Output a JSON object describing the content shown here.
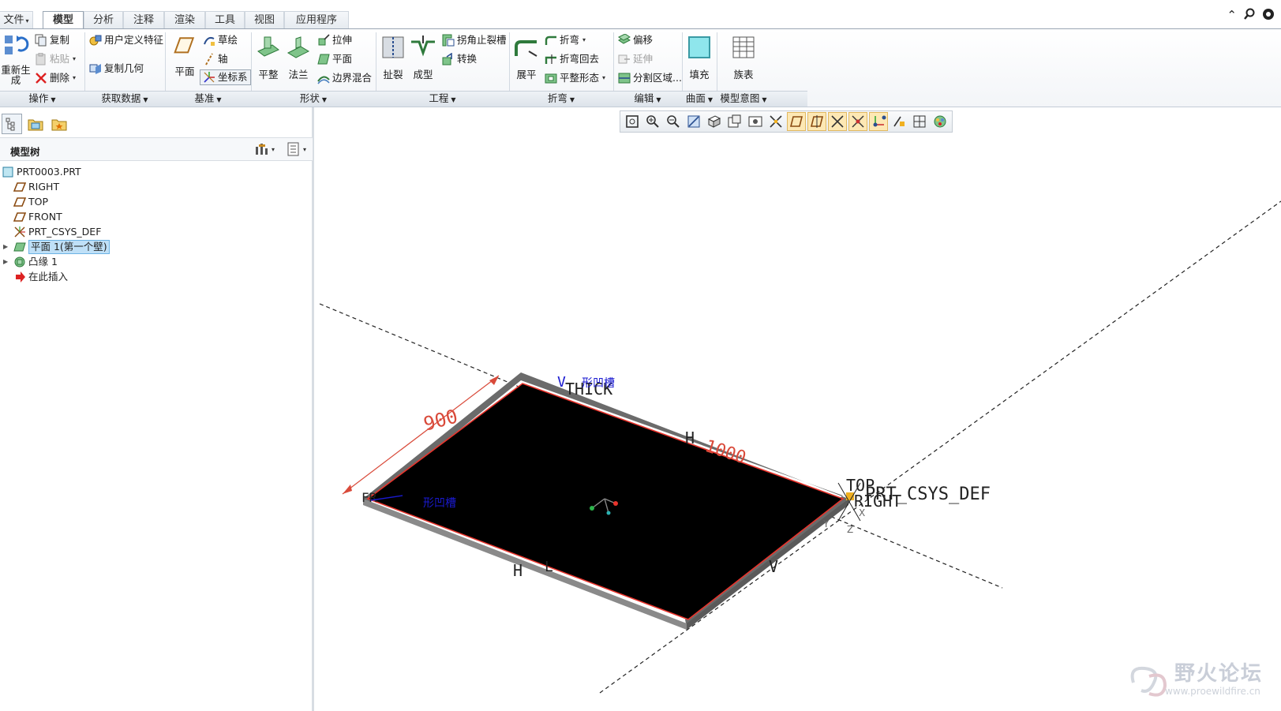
{
  "tabs": [
    {
      "label": "文件",
      "active": false,
      "has_dropdown": true
    },
    {
      "label": "模型",
      "active": true
    },
    {
      "label": "分析",
      "active": false
    },
    {
      "label": "注释",
      "active": false
    },
    {
      "label": "渲染",
      "active": false
    },
    {
      "label": "工具",
      "active": false
    },
    {
      "label": "视图",
      "active": false
    },
    {
      "label": "应用程序",
      "active": false
    }
  ],
  "ribbon": {
    "operations": {
      "regenerate": "重新生成",
      "copy": "复制",
      "paste": "粘贴",
      "delete": "删除",
      "group": "操作"
    },
    "get_data": {
      "udf": "用户定义特征",
      "copy_geom": "复制几何",
      "group": "获取数据"
    },
    "datum": {
      "plane": "平面",
      "sketch": "草绘",
      "axis": "轴",
      "csys": "坐标系",
      "group": "基准"
    },
    "shapes": {
      "flat": "平整",
      "flange": "法兰",
      "extrude": "拉伸",
      "plane": "平面",
      "blend": "边界混合",
      "group": "形状"
    },
    "engineering": {
      "rip": "扯裂",
      "form": "成型",
      "corner_relief": "拐角止裂槽",
      "convert": "转换",
      "group": "工程"
    },
    "bends": {
      "unbend": "展平",
      "bend": "折弯",
      "bend_back": "折弯回去",
      "flat_state": "平整形态",
      "group": "折弯"
    },
    "editing": {
      "offset": "偏移",
      "extend": "延伸",
      "split_area": "分割区域...",
      "group": "编辑"
    },
    "surfaces": {
      "fill": "填充",
      "group": "曲面"
    },
    "model_intent": {
      "family_table": "族表",
      "group": "模型意图"
    }
  },
  "model_tree": {
    "title": "模型树",
    "items": [
      {
        "label": "PRT0003.PRT",
        "icon": "part-icon",
        "indent": 0,
        "expandable": false
      },
      {
        "label": "RIGHT",
        "icon": "datum-plane-icon",
        "indent": 1,
        "expandable": false
      },
      {
        "label": "TOP",
        "icon": "datum-plane-icon",
        "indent": 1,
        "expandable": false
      },
      {
        "label": "FRONT",
        "icon": "datum-plane-icon",
        "indent": 1,
        "expandable": false
      },
      {
        "label": "PRT_CSYS_DEF",
        "icon": "csys-icon",
        "indent": 1,
        "expandable": false
      },
      {
        "label": "平面 1(第一个壁)",
        "icon": "flat-wall-icon",
        "indent": 1,
        "expandable": true,
        "selected": true
      },
      {
        "label": "凸缘 1",
        "icon": "flange-icon",
        "indent": 1,
        "expandable": true
      },
      {
        "label": "在此插入",
        "icon": "insert-here-arrow-icon",
        "indent": 1,
        "expandable": false
      }
    ]
  },
  "view_toolbar": {
    "icons": [
      "refit-icon",
      "zoom-in-icon",
      "zoom-out-icon",
      "repaint-icon",
      "display-style-icon",
      "saved-orientations-icon",
      "named-views-icon",
      "section-icon",
      "datum-display-icon",
      "plane-display-icon",
      "axis-display-icon",
      "point-display-icon",
      "csys-display-icon",
      "annotation-display-icon",
      "spin-center-icon",
      "appearance-icon"
    ]
  },
  "viewport": {
    "dimension_width": "900",
    "dimension_length": "1000",
    "label_thick": "THICK",
    "label_v": "V",
    "label_h_top": "H",
    "label_h_bottom": "H",
    "label_l_bottom": "L",
    "label_v_bottom": "V",
    "label_front": "FR",
    "relief_label_top": "形凹槽",
    "relief_label_left": "形凹槽",
    "label_top": "TOP",
    "label_csys": "PRT_CSYS_DEF",
    "label_right": "RIGHT",
    "label_x": "X",
    "label_y": "Y",
    "label_z": "Z",
    "colors": {
      "plate": "#000000",
      "edge": "#e8342c",
      "side": "#6b6b6b",
      "dimension": "#d94a3a",
      "blue_label": "#1a1ad0"
    }
  },
  "watermark": {
    "title": "野火论坛",
    "url": "www.proewildfire.cn"
  }
}
